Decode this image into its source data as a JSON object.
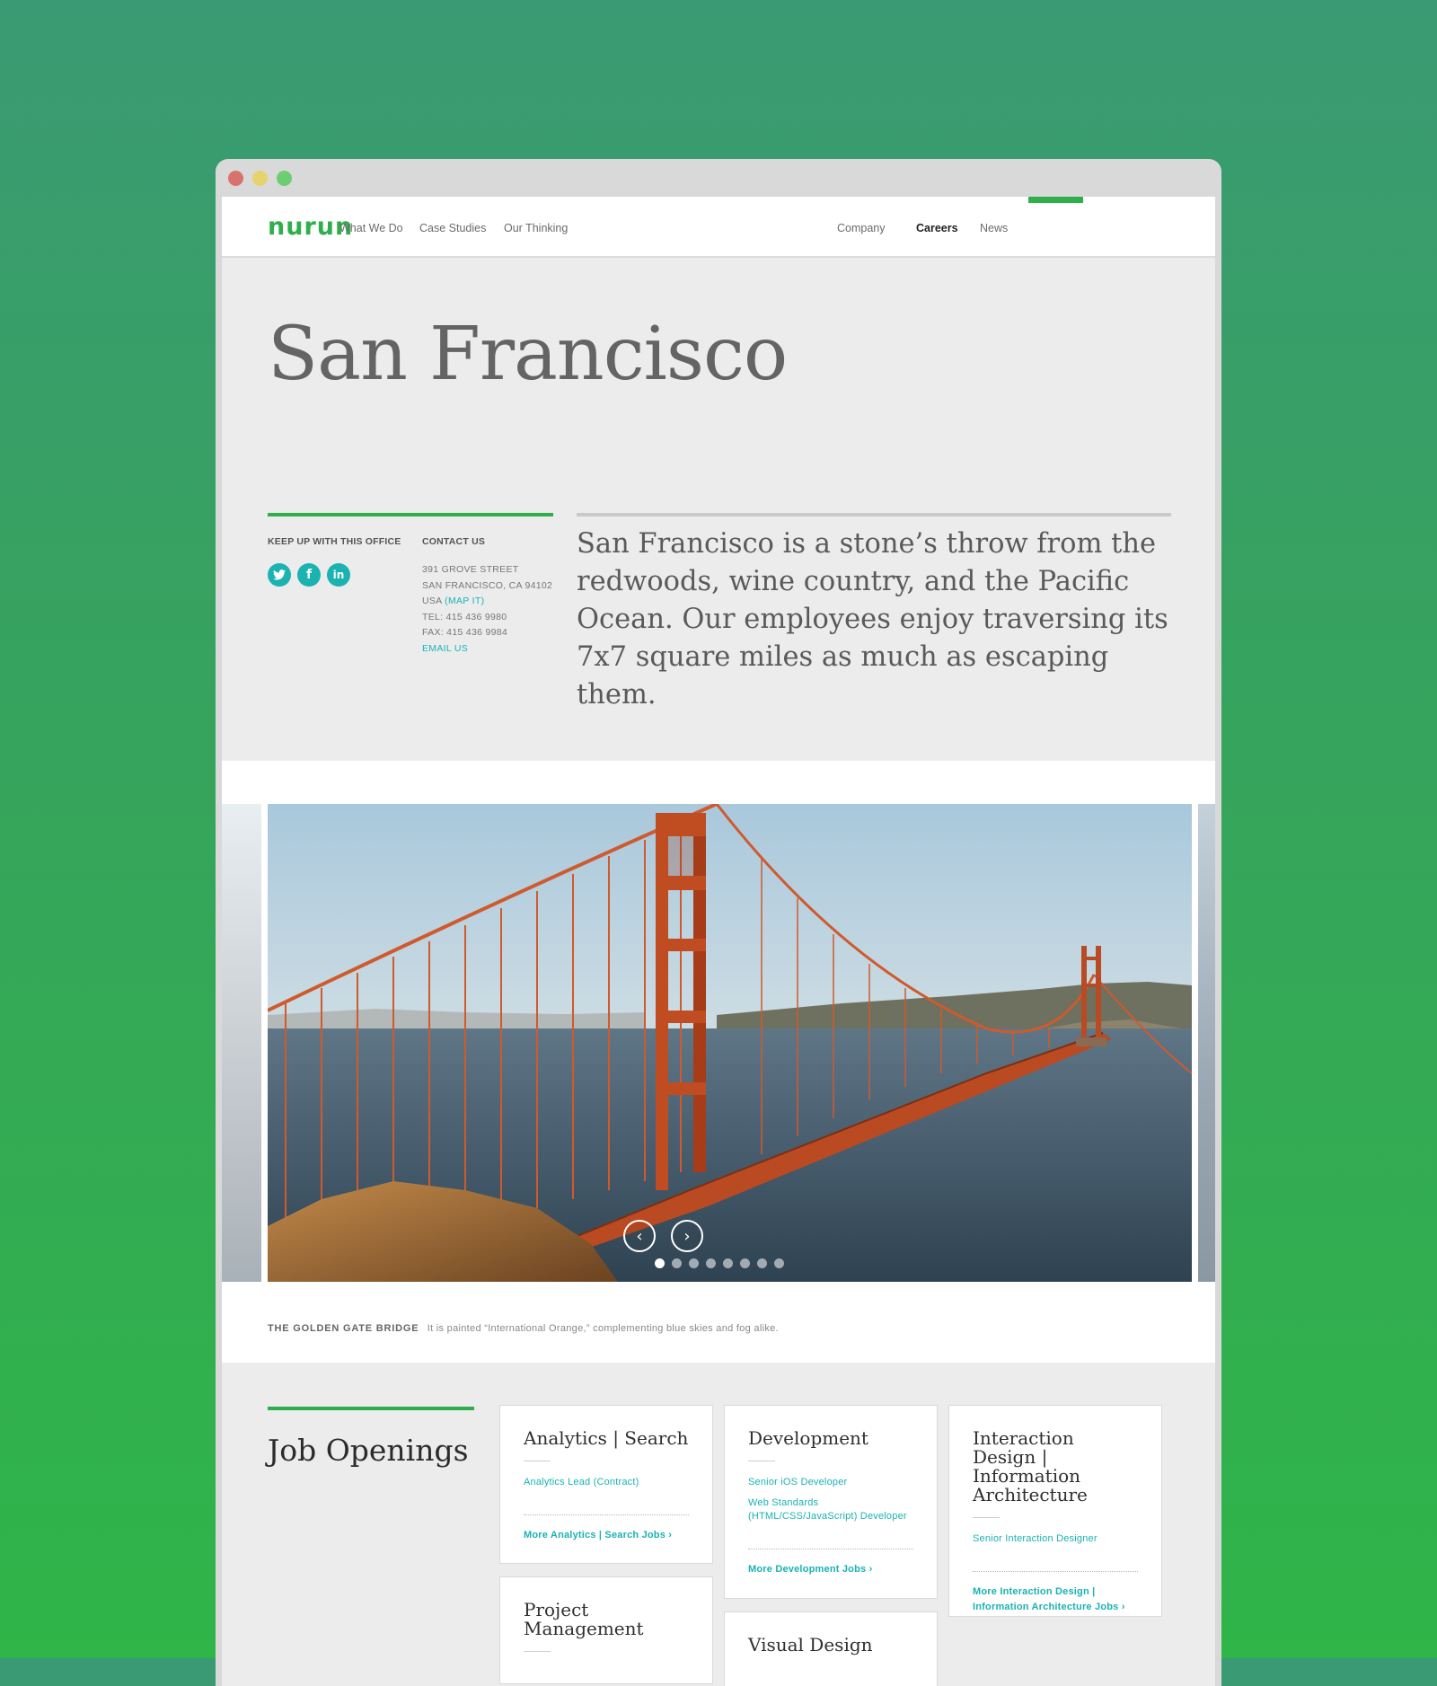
{
  "nav": {
    "logo": "nurun",
    "left_links": [
      "What We Do",
      "Case Studies",
      "Our Thinking"
    ],
    "right_links": [
      "Company",
      "Careers",
      "News"
    ],
    "active": "Careers"
  },
  "hero": {
    "title": "San Francisco",
    "keep_up_label": "KEEP UP WITH THIS OFFICE",
    "contact_label": "CONTACT US",
    "social_icons": [
      "twitter-icon",
      "facebook-icon",
      "linkedin-icon"
    ],
    "address_1": "391 GROVE STREET",
    "address_2": "SAN FRANCISCO, CA 94102",
    "country": "USA",
    "map_link": "MAP IT",
    "tel": "TEL: 415 436 9980",
    "fax": "FAX: 415 436 9984",
    "email_link": "EMAIL US",
    "intro": "San Francisco is a stone’s throw from the redwoods, wine country, and the Pacific Ocean. Our employees enjoy traversing its 7x7 square miles as much as escaping them."
  },
  "gallery": {
    "caption_title": "THE GOLDEN GATE BRIDGE",
    "caption_text": "It is painted “International Orange,” complementing blue skies and fog alike.",
    "slide_count": 8,
    "active_slide": 1
  },
  "jobs": {
    "title": "Job Openings",
    "cards": [
      {
        "title": "Analytics  |  Search",
        "jobs": [
          "Analytics Lead (Contract)"
        ],
        "more": "More Analytics | Search Jobs ›"
      },
      {
        "title": "Development",
        "jobs": [
          "Senior iOS Developer",
          "Web Standards (HTML/CSS/JavaScript) Developer"
        ],
        "more": "More Development Jobs ›"
      },
      {
        "title": "Interaction Design  |  Information Architecture",
        "jobs": [
          "Senior Interaction Designer"
        ],
        "more": "More Interaction Design | Information Architecture Jobs ›"
      },
      {
        "title": "Project Management"
      },
      {
        "title": "Visual Design"
      }
    ]
  },
  "colors": {
    "brand_green": "#2faf4b",
    "link_teal": "#1bb2b2"
  }
}
